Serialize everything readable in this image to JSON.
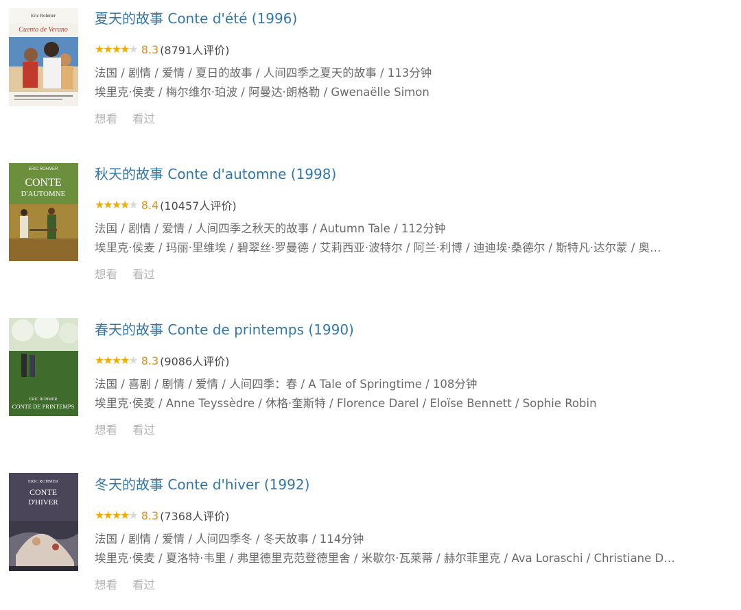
{
  "colors": {
    "title": "#3377aa",
    "star": "#f6ab00",
    "score": "#e09015",
    "meta": "#6a6a6a",
    "action": "#b4b4b4"
  },
  "actions": {
    "want_label": "想看",
    "seen_label": "看过"
  },
  "movies": [
    {
      "title": "夏天的故事 Conte d'été (1996)",
      "stars_full": 4,
      "score": "8.3",
      "votes": "(8791人评价)",
      "meta1": "法国 / 剧情 / 爱情 / 夏日的故事 / 人间四季之夏天的故事 / 113分钟",
      "meta2": "埃里克·侯麦 / 梅尔维尔·珀波 / 阿曼达·朗格勒 / Gwenaëlle Simon",
      "poster_top": "Eric Rohmer",
      "poster_title": "Cuento de Verano"
    },
    {
      "title": "秋天的故事 Conte d'automne (1998)",
      "stars_full": 4,
      "score": "8.4",
      "votes": "(10457人评价)",
      "meta1": "法国 / 剧情 / 爱情 / 人间四季之秋天的故事 / Autumn Tale / 112分钟",
      "meta2": "埃里克·侯麦 / 玛丽·里维埃 / 碧翠丝·罗曼德 / 艾莉西亚·波特尔 / 阿兰·利博 / 迪迪埃·桑德尔 / 斯特凡·达尔蒙 / 奥…",
      "poster_top": "ERIC ROHMER",
      "poster_title": "CONTE",
      "poster_title2": "D'AUTOMNE"
    },
    {
      "title": "春天的故事 Conte de printemps (1990)",
      "stars_full": 4,
      "score": "8.3",
      "votes": "(9086人评价)",
      "meta1": "法国 / 喜剧 / 剧情 / 爱情 / 人间四季：春 / A Tale of Springtime / 108分钟",
      "meta2": "埃里克·侯麦 / Anne Teyssèdre / 休格·奎斯特 / Florence Darel / Eloïse Bennett / Sophie Robin",
      "poster_top": "ERIC ROHMER",
      "poster_title": "CONTE DE PRINTEMPS"
    },
    {
      "title": "冬天的故事 Conte d'hiver (1992)",
      "stars_full": 4,
      "score": "8.3",
      "votes": "(7368人评价)",
      "meta1": "法国 / 剧情 / 爱情 / 人间四季冬 / 冬天故事 / 114分钟",
      "meta2": "埃里克·侯麦 / 夏洛特·韦里 / 弗里德里克范登德里舍 / 米歇尔·瓦莱蒂 / 赫尔菲里克 / Ava Loraschi / Christiane D…",
      "poster_top": "ERIC ROHMER",
      "poster_title": "CONTE",
      "poster_title2": "D'HIVER"
    }
  ]
}
